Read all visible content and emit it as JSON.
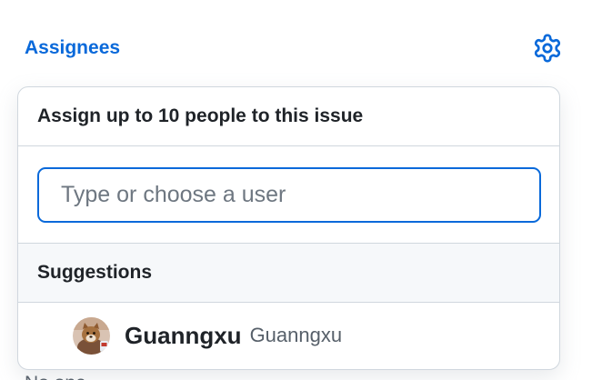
{
  "sidebar": {
    "title": "Assignees",
    "settings_icon": "gear-icon",
    "below_text": "No one—"
  },
  "dropdown": {
    "header": "Assign up to 10 people to this issue",
    "filter": {
      "placeholder": "Type or choose a user",
      "value": ""
    },
    "suggestions_label": "Suggestions",
    "suggestions": [
      {
        "login": "Guanngxu",
        "name": "Guanngxu",
        "avatar_icon": "user-avatar"
      }
    ]
  },
  "colors": {
    "accent": "#0969da",
    "border": "#d0d7de",
    "text": "#1f2328",
    "muted": "#57606a",
    "subtle_bg": "#f6f8fa"
  }
}
